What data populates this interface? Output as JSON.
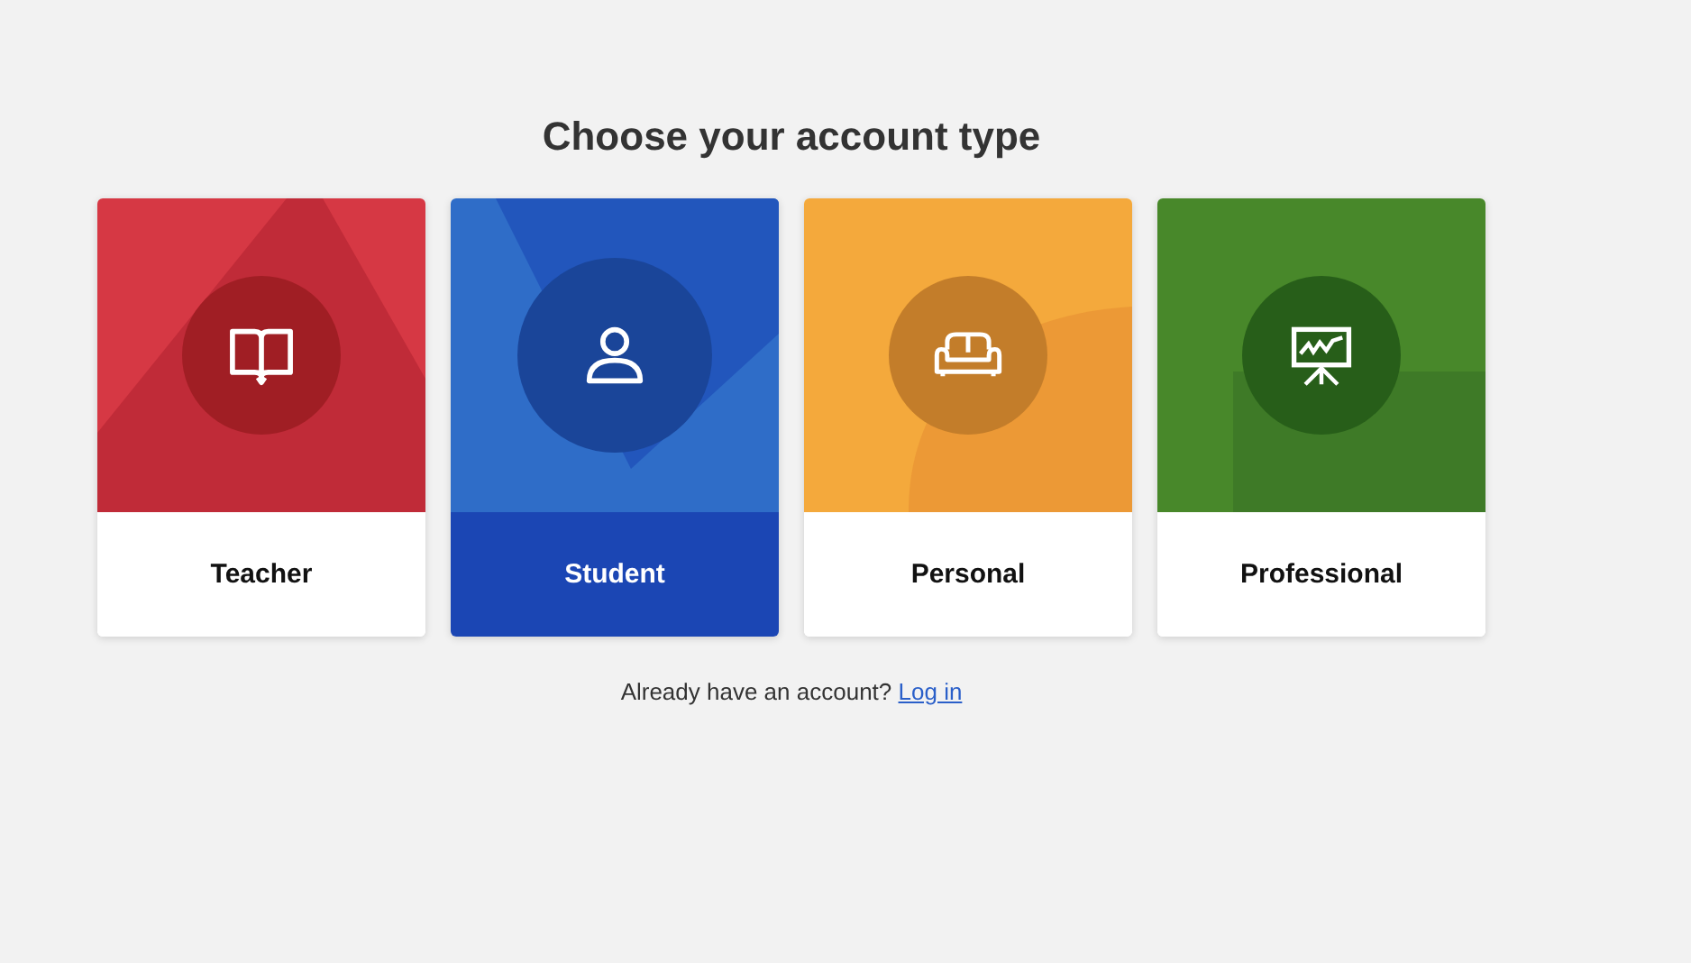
{
  "title": "Choose your account type",
  "cards": [
    {
      "label": "Teacher",
      "kind": "teacher",
      "color": "#d63844",
      "selected": false
    },
    {
      "label": "Student",
      "kind": "student",
      "color": "#2f6dc8",
      "selected": true
    },
    {
      "label": "Personal",
      "kind": "personal",
      "color": "#f4a93c",
      "selected": false
    },
    {
      "label": "Professional",
      "kind": "professional",
      "color": "#48882a",
      "selected": false
    }
  ],
  "footer": {
    "text": "Already have an account?",
    "link": "Log in"
  }
}
